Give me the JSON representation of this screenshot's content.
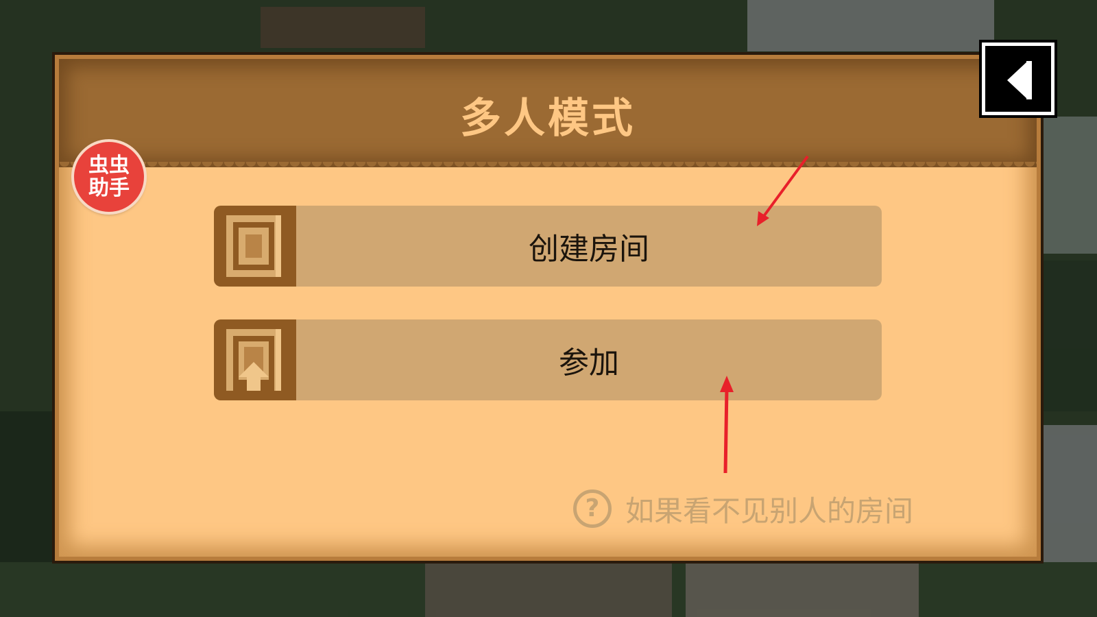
{
  "dialog": {
    "title": "多人模式",
    "back_button": {
      "icon": "back-arrow-icon"
    },
    "buttons": [
      {
        "label": "创建房间",
        "icon": "door-icon"
      },
      {
        "label": "参加",
        "icon": "door-enter-icon"
      }
    ],
    "help": {
      "icon": "question-icon",
      "glyph": "?",
      "text": "如果看不见别人的房间"
    }
  },
  "overlay_badge": {
    "line1": "虫虫",
    "line2": "助手"
  },
  "colors": {
    "panel": "#fec784",
    "header": "#9b6a33",
    "button": "#d0a772",
    "icon_box": "#8f5a22",
    "annotation_arrow": "#e8202a"
  }
}
